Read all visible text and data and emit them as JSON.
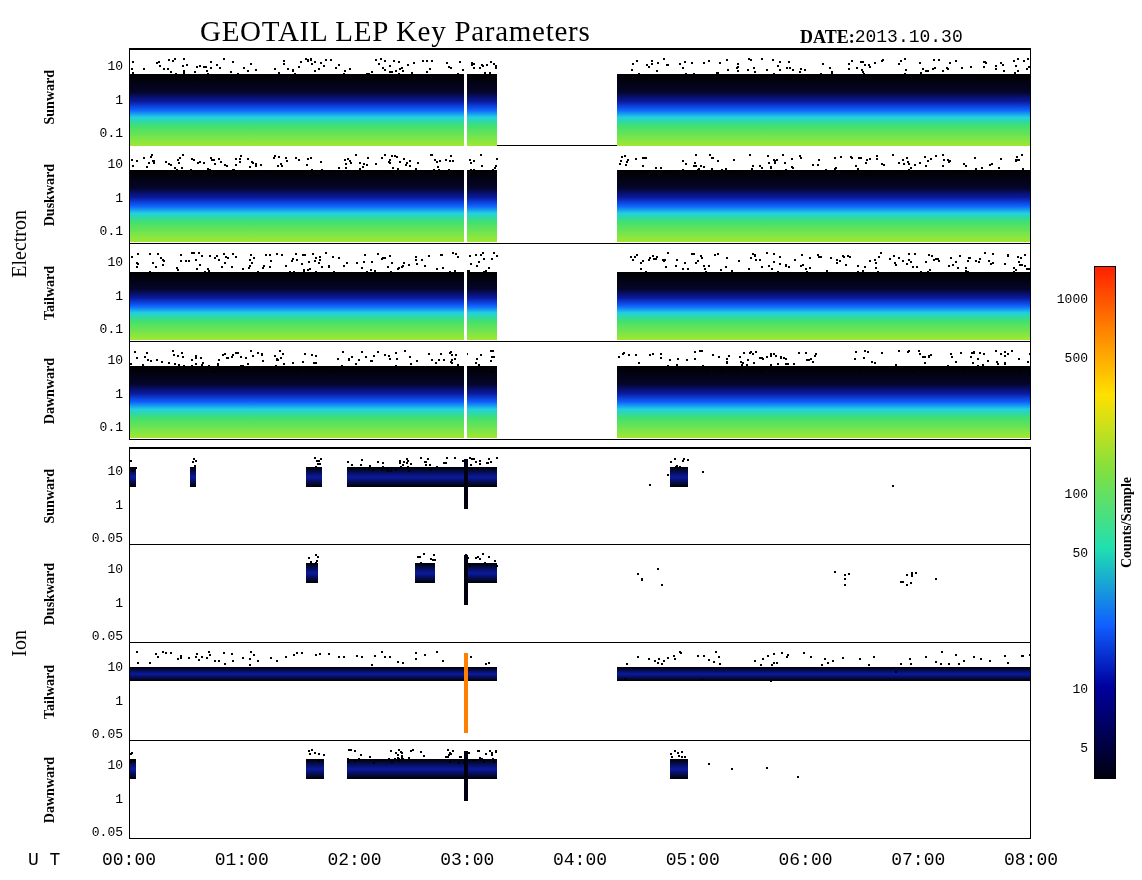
{
  "title": "GEOTAIL LEP Key Parameters",
  "date": {
    "label": "DATE:",
    "value": "2013.10.30"
  },
  "groups": [
    {
      "kind": "electron",
      "label": "Electron",
      "panels": [
        {
          "label": "Sunward",
          "yticks": [
            "10",
            "1",
            "0.1"
          ]
        },
        {
          "label": "Duskward",
          "yticks": [
            "10",
            "1",
            "0.1"
          ]
        },
        {
          "label": "Tailward",
          "yticks": [
            "10",
            "1",
            "0.1"
          ]
        },
        {
          "label": "Dawnward",
          "yticks": [
            "10",
            "1",
            "0.1"
          ]
        }
      ]
    },
    {
      "kind": "ion",
      "label": "Ion",
      "panels": [
        {
          "label": "Sunward",
          "yticks": [
            "10",
            "1",
            "0.05"
          ]
        },
        {
          "label": "Duskward",
          "yticks": [
            "10",
            "1",
            "0.05"
          ]
        },
        {
          "label": "Tailward",
          "yticks": [
            "10",
            "1",
            "0.05"
          ]
        },
        {
          "label": "Dawnward",
          "yticks": [
            "10",
            "1",
            "0.05"
          ]
        }
      ]
    }
  ],
  "x_axis": {
    "label": "U T",
    "ticks": [
      "00:00",
      "01:00",
      "02:00",
      "03:00",
      "04:00",
      "05:00",
      "06:00",
      "07:00",
      "08:00"
    ]
  },
  "colorbar": {
    "label": "Counts/Sample",
    "ticks": [
      "1000",
      "500",
      "100",
      "50",
      "10",
      "5"
    ]
  }
}
